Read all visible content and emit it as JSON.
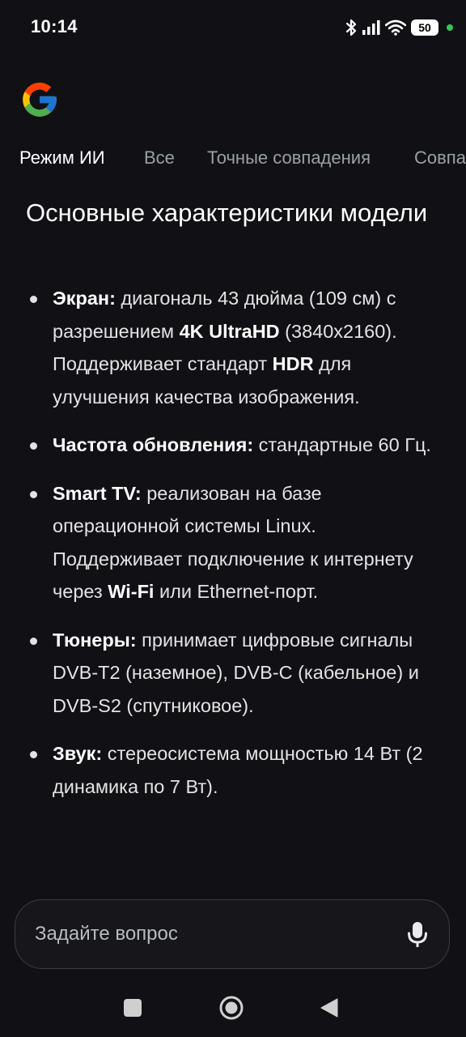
{
  "status_bar": {
    "time": "10:14",
    "battery": "50",
    "icons": [
      "bluetooth-icon",
      "signal-icon",
      "wifi-icon",
      "battery-icon",
      "privacy-dot"
    ]
  },
  "tabs": [
    {
      "label": "Режим ИИ",
      "active": true
    },
    {
      "label": "Все",
      "active": false
    },
    {
      "label": "Точные совпадения",
      "active": false
    },
    {
      "label": "Совпа",
      "active": false
    }
  ],
  "content": {
    "heading": "Основные характеристики модели",
    "items": [
      {
        "label": "Экран:",
        "t1": " диагональ 43 дюйма (109 см) с разрешением ",
        "b1": "4K UltraHD",
        "t2": " (3840x2160). Поддерживает стандарт ",
        "b2": "HDR",
        "t3": " для улучшения качества изображения."
      },
      {
        "label": "Частота обновления:",
        "t1": " стандартные 60 Гц."
      },
      {
        "label": "Smart TV:",
        "t1": " реализован на базе операционной системы Linux. Поддерживает подключение к интернету через ",
        "b1": "Wi-Fi",
        "t2": " или Ethernet-порт."
      },
      {
        "label": "Тюнеры:",
        "t1": " принимает цифровые сигналы DVB-T2 (наземное), DVB-C (кабельное) и DVB-S2 (спутниковое)."
      },
      {
        "label": "Звук:",
        "t1": " стереосистема мощностью 14 Вт (2 динамика по 7 Вт)."
      }
    ]
  },
  "ask_bar": {
    "placeholder": "Задайте вопрос",
    "mic_icon": "microphone-icon"
  },
  "nav_bar": {
    "icons": [
      "recents-square-icon",
      "home-circle-icon",
      "back-triangle-icon"
    ]
  },
  "colors": {
    "background": "#111115",
    "text_primary": "#ffffff",
    "text_secondary": "#9aa0a6",
    "accent_green_dot": "#34c759"
  }
}
